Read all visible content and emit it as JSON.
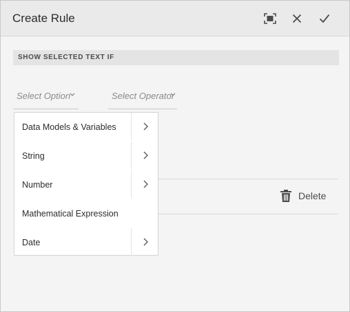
{
  "dialog": {
    "title": "Create Rule",
    "fullscreen_icon": "fullscreen-icon",
    "close_icon": "close-icon",
    "confirm_icon": "checkmark-icon"
  },
  "condition": {
    "section_label": "SHOW SELECTED TEXT IF",
    "select_option_placeholder": "Select Option",
    "select_operator_placeholder": "Select Operator",
    "delete_label": "Delete",
    "delete_icon": "trash-icon"
  },
  "menu": {
    "items": [
      {
        "label": "Data Models & Variables",
        "has_submenu": true
      },
      {
        "label": "String",
        "has_submenu": true
      },
      {
        "label": "Number",
        "has_submenu": true
      },
      {
        "label": "Mathematical Expression",
        "has_submenu": false
      },
      {
        "label": "Date",
        "has_submenu": true
      }
    ]
  },
  "colors": {
    "header_bg": "#eaeaea",
    "body_bg": "#f4f4f4",
    "section_bg": "#e4e4e4",
    "menu_bg": "#ffffff"
  }
}
